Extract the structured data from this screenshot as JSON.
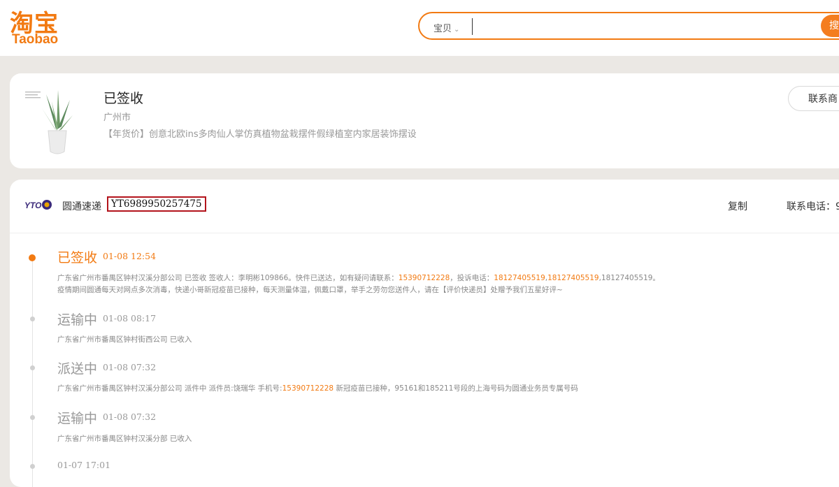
{
  "header": {
    "logo_cn": "淘宝",
    "logo_en": "Taobao",
    "search": {
      "category": "宝贝",
      "value": "",
      "button": "搜"
    }
  },
  "order": {
    "status": "已签收",
    "city": "广州市",
    "product": "【年货价】创意北欧ins多肉仙人掌仿真植物盆栽摆件假绿植室内家居装饰摆设",
    "contact_button": "联系商"
  },
  "shipment": {
    "courier_logo": "YTO",
    "courier_name": "圆通速递",
    "tracking_number": "YT6989950257475",
    "copy_label": "复制",
    "phone_label": "联系电话：9"
  },
  "timeline": [
    {
      "status": "已签收",
      "time": "01-08 12:54",
      "lines": [
        [
          "广东省广州市番禺区钟村汉溪分部公司 已签收 签收人：李明彬109866。快件已送达，如有疑问请联系：",
          "15390712228",
          "，投诉电话：",
          "18127405519",
          ",",
          "18127405519",
          ",18127405519。"
        ],
        [
          "疫情期间圆通每天对网点多次消毒，快递小哥新冠疫苗已接种，每天测量体温，佩戴口罩，举手之劳勿您送件人，请在【评价快递员】处赠予我们五星好评~"
        ]
      ],
      "active": true
    },
    {
      "status": "运输中",
      "time": "01-08 08:17",
      "detail": "广东省广州市番禺区钟村街西公司 已收入",
      "active": false
    },
    {
      "status": "派送中",
      "time": "01-08 07:32",
      "detail_parts": [
        "广东省广州市番禺区钟村汉溪分部公司 派件中 派件员:饶瑞华 手机号:",
        "15390712228",
        " 新冠疫苗已接种，95161和185211号段的上海号码为圆通业务员专属号码"
      ],
      "active": false
    },
    {
      "status": "运输中",
      "time": "01-08 07:32",
      "detail": "广东省广州市番禺区钟村汉溪分部 已收入",
      "active": false
    },
    {
      "status": "",
      "time": "01-07 17:01",
      "active": false
    }
  ],
  "colors": {
    "brand": "#f27a12",
    "highlight_box": "#b3141c",
    "page_bg": "#ebe8e4"
  },
  "icons": [
    "search-icon",
    "chevron-down-icon",
    "plant-product-image",
    "yto-logo"
  ]
}
